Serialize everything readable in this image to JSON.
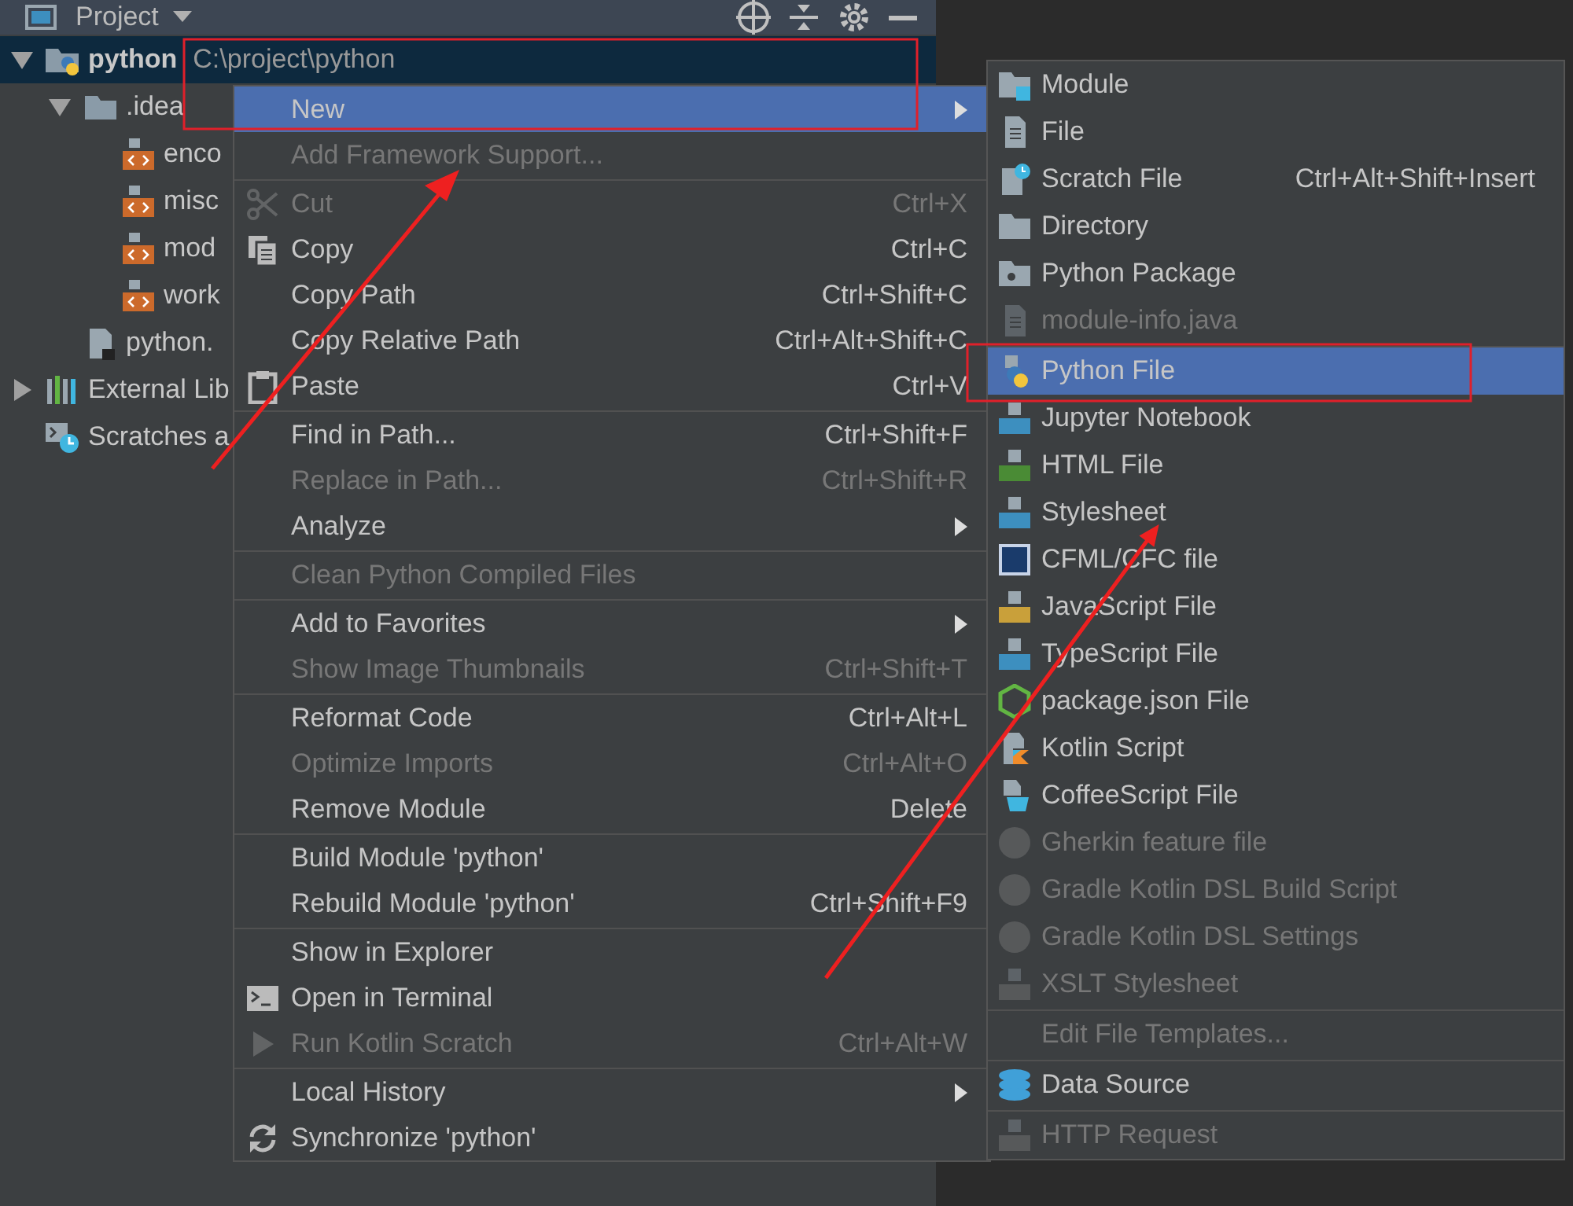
{
  "panel": {
    "title": "Project"
  },
  "tree": [
    {
      "label": "python",
      "path": "C:\\project\\python",
      "expanded": true,
      "selected": true,
      "children": [
        {
          "label": ".idea",
          "expanded": true,
          "selected": false,
          "children": [
            {
              "label": "enco",
              "selected": false
            },
            {
              "label": "misc",
              "selected": false
            },
            {
              "label": "mod",
              "selected": false
            },
            {
              "label": "work",
              "selected": false
            }
          ]
        },
        {
          "label": "python.",
          "selected": false
        }
      ]
    },
    {
      "label": "External Lib",
      "expanded": false,
      "selected": false
    },
    {
      "label": "Scratches a",
      "selected": false
    }
  ],
  "context_menu": [
    {
      "kind": "item",
      "label": "New",
      "submenu": true,
      "disabled": false,
      "selected": true
    },
    {
      "kind": "item",
      "label": "Add Framework Support...",
      "submenu": false,
      "disabled": true,
      "selected": false
    },
    {
      "kind": "separator"
    },
    {
      "kind": "item",
      "label": "Cut",
      "shortcut": "Ctrl+X",
      "submenu": false,
      "disabled": true,
      "selected": false
    },
    {
      "kind": "item",
      "label": "Copy",
      "shortcut": "Ctrl+C",
      "submenu": false,
      "disabled": false,
      "selected": false
    },
    {
      "kind": "item",
      "label": "Copy Path",
      "shortcut": "Ctrl+Shift+C",
      "submenu": false,
      "disabled": false,
      "selected": false
    },
    {
      "kind": "item",
      "label": "Copy Relative Path",
      "shortcut": "Ctrl+Alt+Shift+C",
      "submenu": false,
      "disabled": false,
      "selected": false
    },
    {
      "kind": "item",
      "label": "Paste",
      "shortcut": "Ctrl+V",
      "submenu": false,
      "disabled": false,
      "selected": false
    },
    {
      "kind": "separator"
    },
    {
      "kind": "item",
      "label": "Find in Path...",
      "shortcut": "Ctrl+Shift+F",
      "submenu": false,
      "disabled": false,
      "selected": false
    },
    {
      "kind": "item",
      "label": "Replace in Path...",
      "shortcut": "Ctrl+Shift+R",
      "submenu": false,
      "disabled": true,
      "selected": false
    },
    {
      "kind": "item",
      "label": "Analyze",
      "submenu": true,
      "disabled": false,
      "selected": false
    },
    {
      "kind": "separator"
    },
    {
      "kind": "item",
      "label": "Clean Python Compiled Files",
      "submenu": false,
      "disabled": true,
      "selected": false
    },
    {
      "kind": "separator"
    },
    {
      "kind": "item",
      "label": "Add to Favorites",
      "submenu": true,
      "disabled": false,
      "selected": false
    },
    {
      "kind": "item",
      "label": "Show Image Thumbnails",
      "shortcut": "Ctrl+Shift+T",
      "submenu": false,
      "disabled": true,
      "selected": false
    },
    {
      "kind": "separator"
    },
    {
      "kind": "item",
      "label": "Reformat Code",
      "shortcut": "Ctrl+Alt+L",
      "submenu": false,
      "disabled": false,
      "selected": false
    },
    {
      "kind": "item",
      "label": "Optimize Imports",
      "shortcut": "Ctrl+Alt+O",
      "submenu": false,
      "disabled": true,
      "selected": false
    },
    {
      "kind": "item",
      "label": "Remove Module",
      "shortcut": "Delete",
      "submenu": false,
      "disabled": false,
      "selected": false
    },
    {
      "kind": "separator"
    },
    {
      "kind": "item",
      "label": "Build Module 'python'",
      "submenu": false,
      "disabled": false,
      "selected": false
    },
    {
      "kind": "item",
      "label": "Rebuild Module 'python'",
      "shortcut": "Ctrl+Shift+F9",
      "submenu": false,
      "disabled": false,
      "selected": false
    },
    {
      "kind": "separator"
    },
    {
      "kind": "item",
      "label": "Show in Explorer",
      "submenu": false,
      "disabled": false,
      "selected": false
    },
    {
      "kind": "item",
      "label": "Open in Terminal",
      "submenu": false,
      "disabled": false,
      "selected": false
    },
    {
      "kind": "item",
      "label": "Run Kotlin Scratch",
      "shortcut": "Ctrl+Alt+W",
      "submenu": false,
      "disabled": true,
      "selected": false
    },
    {
      "kind": "separator"
    },
    {
      "kind": "item",
      "label": "Local History",
      "submenu": true,
      "disabled": false,
      "selected": false
    },
    {
      "kind": "item",
      "label": "Synchronize 'python'",
      "submenu": false,
      "disabled": false,
      "selected": false
    }
  ],
  "new_submenu": [
    {
      "kind": "item",
      "label": "Module",
      "disabled": false,
      "selected": false
    },
    {
      "kind": "item",
      "label": "File",
      "disabled": false,
      "selected": false
    },
    {
      "kind": "item",
      "label": "Scratch File",
      "shortcut": "Ctrl+Alt+Shift+Insert",
      "disabled": false,
      "selected": false
    },
    {
      "kind": "item",
      "label": "Directory",
      "disabled": false,
      "selected": false
    },
    {
      "kind": "item",
      "label": "Python Package",
      "disabled": false,
      "selected": false
    },
    {
      "kind": "item",
      "label": "module-info.java",
      "disabled": true,
      "selected": false
    },
    {
      "kind": "separator"
    },
    {
      "kind": "item",
      "label": "Python File",
      "disabled": false,
      "selected": true
    },
    {
      "kind": "item",
      "label": "Jupyter Notebook",
      "disabled": false,
      "selected": false
    },
    {
      "kind": "item",
      "label": "HTML File",
      "disabled": false,
      "selected": false
    },
    {
      "kind": "item",
      "label": "Stylesheet",
      "disabled": false,
      "selected": false
    },
    {
      "kind": "item",
      "label": "CFML/CFC file",
      "disabled": false,
      "selected": false
    },
    {
      "kind": "item",
      "label": "JavaScript File",
      "disabled": false,
      "selected": false
    },
    {
      "kind": "item",
      "label": "TypeScript File",
      "disabled": false,
      "selected": false
    },
    {
      "kind": "item",
      "label": "package.json File",
      "disabled": false,
      "selected": false
    },
    {
      "kind": "item",
      "label": "Kotlin Script",
      "disabled": false,
      "selected": false
    },
    {
      "kind": "item",
      "label": "CoffeeScript File",
      "disabled": false,
      "selected": false
    },
    {
      "kind": "item",
      "label": "Gherkin feature file",
      "disabled": true,
      "selected": false
    },
    {
      "kind": "item",
      "label": "Gradle Kotlin DSL Build Script",
      "disabled": true,
      "selected": false
    },
    {
      "kind": "item",
      "label": "Gradle Kotlin DSL Settings",
      "disabled": true,
      "selected": false
    },
    {
      "kind": "item",
      "label": "XSLT Stylesheet",
      "disabled": true,
      "selected": false
    },
    {
      "kind": "separator"
    },
    {
      "kind": "item",
      "label": "Edit File Templates...",
      "disabled": true,
      "selected": false
    },
    {
      "kind": "separator"
    },
    {
      "kind": "item",
      "label": "Data Source",
      "disabled": false,
      "selected": false
    },
    {
      "kind": "separator"
    },
    {
      "kind": "item",
      "label": "HTTP Request",
      "disabled": true,
      "selected": false
    }
  ]
}
